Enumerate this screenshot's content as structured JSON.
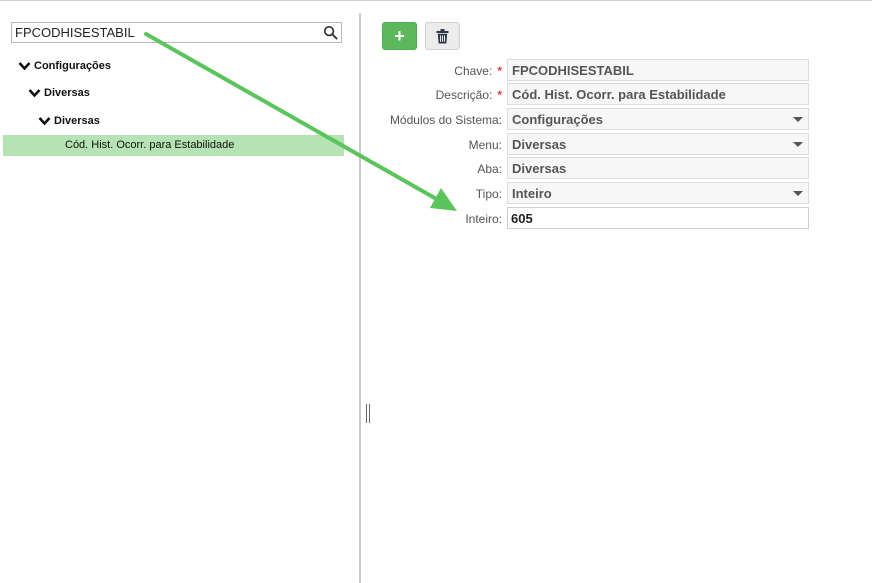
{
  "search": {
    "value": "FPCODHISESTABIL"
  },
  "tree": {
    "nodes": [
      {
        "label": "Configurações"
      },
      {
        "label": "Diversas"
      },
      {
        "label": "Diversas"
      }
    ],
    "selected_item": "Cód. Hist. Ocorr. para Estabilidade"
  },
  "toolbar": {
    "add_symbol": "+",
    "delete_icon": "trash-icon"
  },
  "form": {
    "chave": {
      "label": "Chave:",
      "value": "FPCODHISESTABIL",
      "required": "*"
    },
    "descricao": {
      "label": "Descrição:",
      "value": "Cód. Hist. Ocorr. para Estabilidade",
      "required": "*"
    },
    "modulos": {
      "label": "Módulos do Sistema:",
      "value": "Configurações"
    },
    "menu": {
      "label": "Menu:",
      "value": "Diversas"
    },
    "aba": {
      "label": "Aba:",
      "value": "Diversas"
    },
    "tipo": {
      "label": "Tipo:",
      "value": "Inteiro"
    },
    "inteiro": {
      "label": "Inteiro:",
      "value": "605"
    }
  },
  "colors": {
    "accent_green": "#5cb85c",
    "selection_bg": "#b6e3b3",
    "required_star": "#d9443c",
    "annotation_arrow": "#5cc45c"
  }
}
